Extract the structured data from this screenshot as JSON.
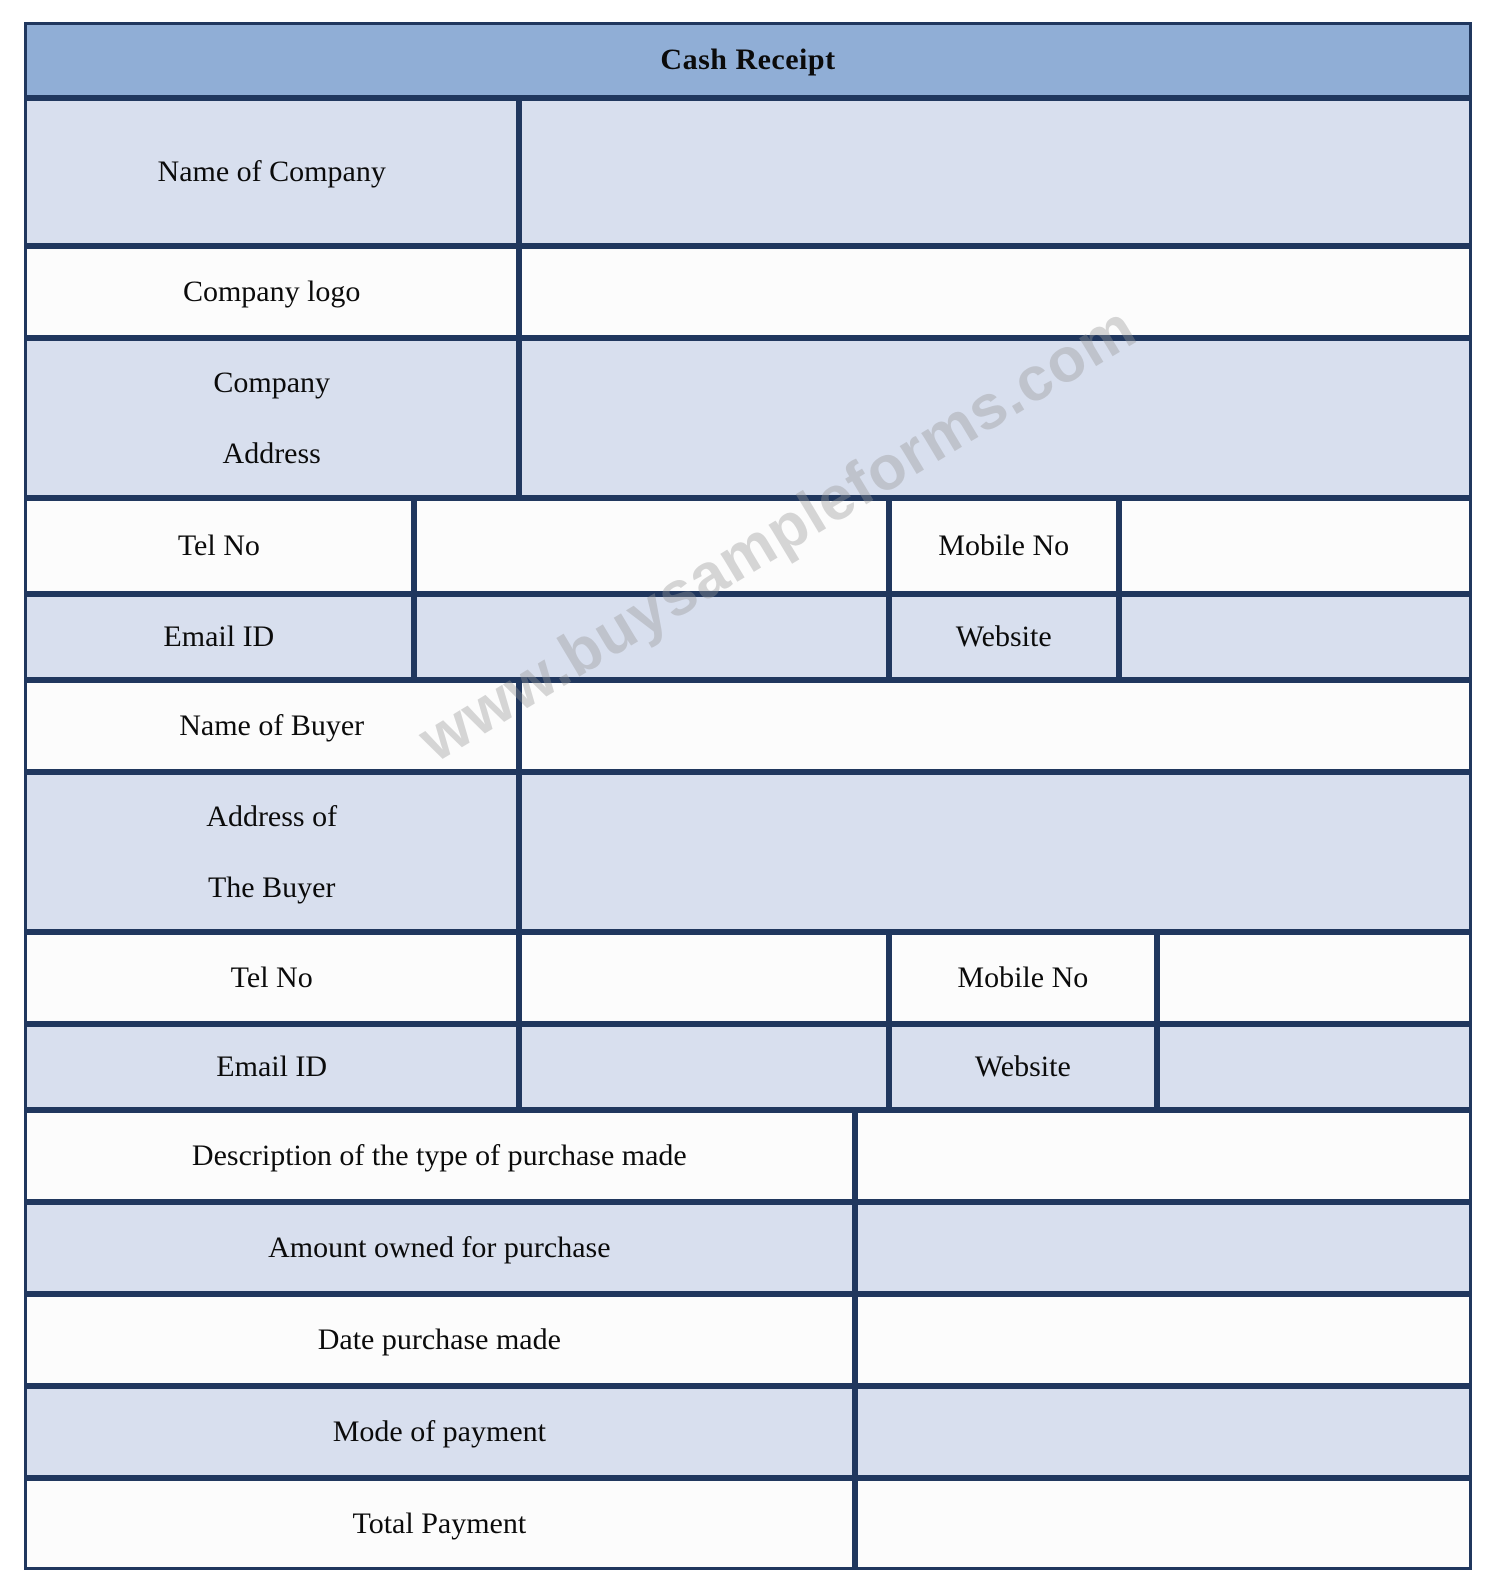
{
  "document": {
    "title": "Cash Receipt",
    "watermark": "www.buysampleforms.com"
  },
  "colors": {
    "header_fill": "#90AED6",
    "row_fill_blue": "#D8DFEE",
    "row_fill_white": "#FCFCFC",
    "border": "#20375E",
    "text": "#0B0B0B",
    "watermark_text": "#969696"
  },
  "company_section": {
    "name_of_company_label": "Name of Company",
    "name_of_company_value": "",
    "company_logo_label": "Company logo",
    "company_logo_value": "",
    "company_address_label_line1": "Company",
    "company_address_label_line2": "Address",
    "company_address_value": "",
    "tel_no_label": "Tel No",
    "tel_no_value": "",
    "mobile_no_label": "Mobile No",
    "mobile_no_value": "",
    "email_id_label": "Email ID",
    "email_id_value": "",
    "website_label": "Website",
    "website_value": ""
  },
  "buyer_section": {
    "name_of_buyer_label": "Name of Buyer",
    "name_of_buyer_value": "",
    "address_label_line1": "Address of",
    "address_label_line2": "The Buyer",
    "address_value": "",
    "tel_no_label": "Tel No",
    "tel_no_value": "",
    "mobile_no_label": "Mobile No",
    "mobile_no_value": "",
    "email_id_label": "Email ID",
    "email_id_value": "",
    "website_label": "Website",
    "website_value": ""
  },
  "purchase_section": {
    "description_label": "Description of the type of purchase made",
    "description_value": "",
    "amount_label": "Amount owned for purchase",
    "amount_value": "",
    "date_label": "Date purchase made",
    "date_value": "",
    "mode_label": "Mode of payment",
    "mode_value": "",
    "total_label": "Total Payment",
    "total_value": ""
  }
}
